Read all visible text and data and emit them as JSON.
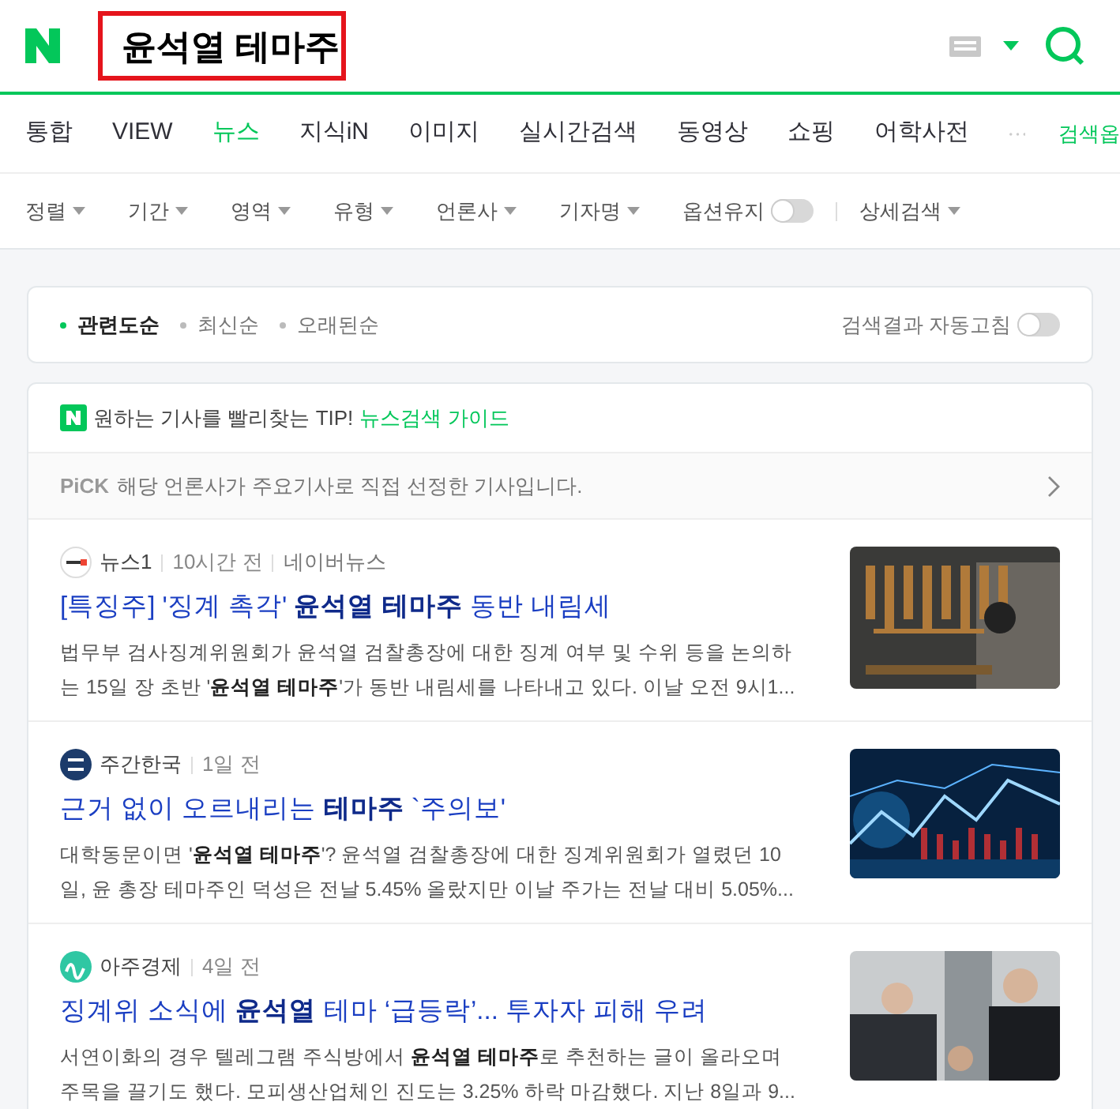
{
  "header": {
    "query": "윤석열 테마주",
    "highlighted": true
  },
  "tabs": [
    {
      "label": "통합",
      "selected": false
    },
    {
      "label": "VIEW",
      "selected": false
    },
    {
      "label": "뉴스",
      "selected": true
    },
    {
      "label": "지식iN",
      "selected": false
    },
    {
      "label": "이미지",
      "selected": false
    },
    {
      "label": "실시간검색",
      "selected": false
    },
    {
      "label": "동영상",
      "selected": false
    },
    {
      "label": "쇼핑",
      "selected": false
    },
    {
      "label": "어학사전",
      "selected": false
    }
  ],
  "search_options": "검색옵",
  "filters": [
    {
      "kind": "dropdown",
      "label": "정렬"
    },
    {
      "kind": "dropdown",
      "label": "기간"
    },
    {
      "kind": "dropdown",
      "label": "영역"
    },
    {
      "kind": "dropdown",
      "label": "유형"
    },
    {
      "kind": "dropdown",
      "label": "언론사"
    },
    {
      "kind": "dropdown",
      "label": "기자명"
    },
    {
      "kind": "toggle",
      "label": "옵션유지",
      "on": false
    },
    {
      "kind": "dropdown",
      "label": "상세검색"
    }
  ],
  "sort": {
    "options": [
      {
        "label": "관련도순",
        "selected": true
      },
      {
        "label": "최신순",
        "selected": false
      },
      {
        "label": "오래된순",
        "selected": false
      }
    ],
    "auto_refresh": {
      "label": "검색결과 자동고침",
      "on": false
    }
  },
  "tip": {
    "text": "원하는 기사를 빨리찾는 TIP!",
    "link": "뉴스검색 가이드"
  },
  "pick": {
    "badge": "PiCK",
    "text": "해당 언론사가 주요기사로 직접 선정한 기사입니다."
  },
  "articles": [
    {
      "source": "뉴스1",
      "time": "10시간 전",
      "extra": "네이버뉴스",
      "title": "[특징주] '징계 촉각' **윤석열 테마주** 동반 내림세",
      "lines": [
        "법무부 검사징계위원회가 윤석열 검찰총장에 대한 징계 여부 및 수위 등을 논의하",
        "는 15일 장 초반 '**윤석열 테마주**'가 동반 내림세를 나타내고 있다. 이날 오전 9시1..."
      ],
      "logo": {
        "kind": "news1"
      }
    },
    {
      "source": "주간한국",
      "time": "1일 전",
      "title": "근거 없이 오르내리는 **테마주** `주의보'",
      "lines": [
        "대학동문이면 '**윤석열 테마주**'? 윤석열 검찰총장에 대한 징계위원회가 열렸던 10",
        "일, 윤 총장 테마주인 덕성은 전날 5.45% 올랐지만 이날 주가는 전날 대비 5.05%..."
      ],
      "logo": {
        "kind": "circle"
      }
    },
    {
      "source": "아주경제",
      "time": "4일 전",
      "title": "징계위 소식에 **윤석열** 테마 ‘급등락’... 투자자 피해 우려",
      "lines": [
        "서연이화의 경우 텔레그램 주식방에서 **윤석열 테마주**로 추천하는 글이 올라오며",
        "주목을 끌기도 했다. 모피생산업체인 진도는 3.25% 하락 마감했다. 지난 8일과 9..."
      ],
      "logo": {
        "kind": "wave"
      }
    }
  ]
}
